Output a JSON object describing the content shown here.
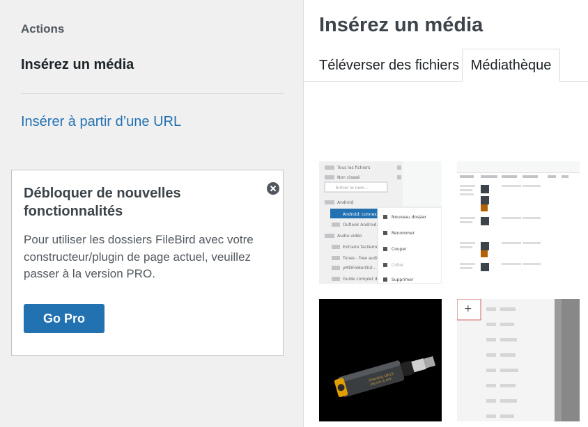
{
  "sidebar": {
    "heading": "Actions",
    "active_item": "Insérez un média",
    "url_link": "Insérer à partir d’une URL"
  },
  "promo": {
    "title": "Débloquer de nouvelles fonctionnalités",
    "text": "Pour utiliser les dossiers FileBird avec votre constructeur/plugin de page actuel, veuillez passer à la version PRO.",
    "button": "Go Pro",
    "close_icon": "close-icon"
  },
  "panel": {
    "title": "Insérez un média",
    "tabs": [
      {
        "label": "Téléverser des fichiers",
        "active": false
      },
      {
        "label": "Médiathèque",
        "active": true
      }
    ]
  },
  "thumbnails": [
    {
      "label": "screenshot-filebird-folders",
      "sidebar_items": [
        "Tous les fichiers",
        "Non classé",
        "Entrer le nom...",
        "Android",
        "Android: connexion...",
        "Outlook Android...",
        "Audio-vidéo",
        "Extraire facilement...",
        "Tunes - free audio...",
        "yMDFolderDUI...",
        "Guide complet de..."
      ],
      "context_menu": [
        "Nouveau dossier",
        "Renommer",
        "Couper",
        "Coller",
        "Supprimer"
      ]
    },
    {
      "label": "screenshot-media-list"
    },
    {
      "label": "photo-usb-dac-device",
      "device_text": [
        "Shanling UA1S",
        "USB DAC & AMP"
      ]
    },
    {
      "label": "screenshot-blurred-menu",
      "plus_glyph": "+"
    }
  ],
  "colors": {
    "accent": "#2271b1",
    "sidebar_bg": "#f0f0f1",
    "border": "#dcdcde"
  }
}
